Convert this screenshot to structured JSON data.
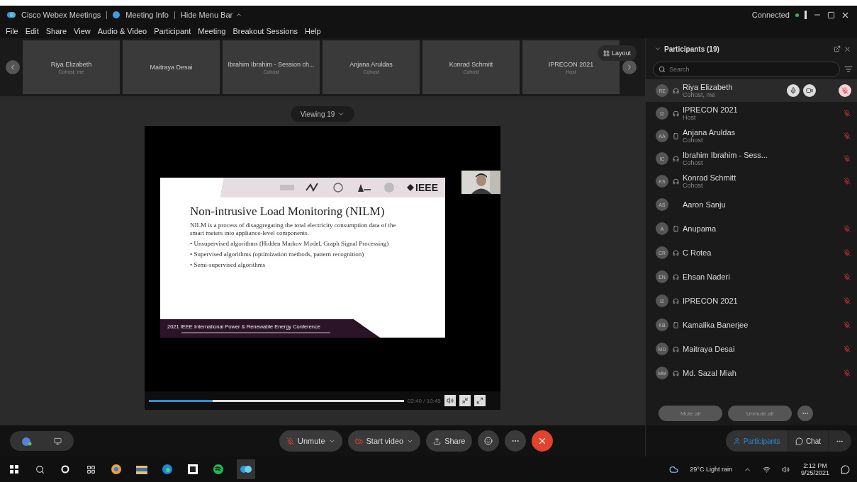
{
  "title_bar": {
    "app": "Cisco Webex Meetings",
    "meeting_info": "Meeting Info",
    "hide_menu": "Hide Menu Bar",
    "status": "Connected"
  },
  "menu": [
    "File",
    "Edit",
    "Share",
    "View",
    "Audio & Video",
    "Participant",
    "Meeting",
    "Breakout Sessions",
    "Help"
  ],
  "filmstrip": [
    {
      "name": "Riya Elizabeth",
      "role": "Cohost, me"
    },
    {
      "name": "Maitraya Desai"
    },
    {
      "name": "Ibrahim Ibrahim - Session ch...",
      "role": "Cohost"
    },
    {
      "name": "Anjana Aruldas",
      "role": "Cohost"
    },
    {
      "name": "Konrad Schmitt",
      "role": "Cohost"
    },
    {
      "name": "IPRECON 2021",
      "role": "Host"
    }
  ],
  "layout_button": "Layout",
  "viewing": "Viewing 19",
  "slide": {
    "logo_text": "IEEE",
    "title": "Non-intrusive Load Monitoring (NILM)",
    "paragraph": "NILM is a process of disaggregating the total electricity consumption data of the smart meters into appliance-level components.",
    "bullets": [
      "• Unsupervised algorithms (Hidden Markov Model, Graph Signal Processing)",
      "• Supervised algorithms (optimization methods, pattern recognition)",
      "• Semi-supervised algorithms"
    ],
    "footer": "2021 IEEE International Power & Renewable Energy Conference"
  },
  "player": {
    "level": 0.25,
    "time": "02:40 / 10:45"
  },
  "panel": {
    "title": "Participants (19)",
    "search_placeholder": "Search",
    "participants": [
      {
        "initials": "RE",
        "name": "Riya Elizabeth",
        "role": "Cohost, me",
        "kind": "headset",
        "muted": true,
        "selected": true
      },
      {
        "initials": "I2",
        "name": "IPRECON 2021",
        "role": "Host",
        "kind": "headset",
        "muted": true,
        "selected": false
      },
      {
        "initials": "AA",
        "name": "Anjana Aruldas",
        "role": "Cohost",
        "kind": "phone",
        "muted": true,
        "selected": false
      },
      {
        "initials": "IC",
        "name": "Ibrahim Ibrahim - Sess...",
        "role": "Cohost",
        "kind": "headset",
        "muted": true,
        "selected": false
      },
      {
        "initials": "KS",
        "name": "Konrad Schmitt",
        "role": "Cohost",
        "kind": "headset",
        "muted": true,
        "selected": false
      },
      {
        "initials": "AS",
        "name": "Aaron Sanju",
        "kind": "plain",
        "muted": false,
        "selected": false
      },
      {
        "initials": "A",
        "name": "Anupama",
        "kind": "phone",
        "muted": true,
        "selected": false
      },
      {
        "initials": "CR",
        "name": "C Rotea",
        "kind": "headset",
        "muted": true,
        "selected": false
      },
      {
        "initials": "EN",
        "name": "Ehsan Naderi",
        "kind": "headset",
        "muted": true,
        "selected": false
      },
      {
        "initials": "I2",
        "name": "IPRECON 2021",
        "kind": "headset",
        "muted": true,
        "selected": false
      },
      {
        "initials": "KB",
        "name": "Kamalika Banerjee",
        "kind": "phone",
        "muted": true,
        "selected": false
      },
      {
        "initials": "MD",
        "name": "Maitraya Desai",
        "kind": "headset",
        "muted": true,
        "selected": false
      },
      {
        "initials": "MM",
        "name": "Md. Sazal Miah",
        "kind": "headset",
        "muted": true,
        "selected": false
      }
    ],
    "buttons": [
      "Mute all",
      "Unmute all"
    ]
  },
  "controls": {
    "unmute": "Unmute",
    "video": "Start video",
    "share": "Share"
  },
  "side_tabs": [
    {
      "label": "Participants",
      "selected": true
    },
    {
      "label": "Chat",
      "selected": false
    }
  ],
  "taskbar": {
    "weather": "29°C  Light rain",
    "time": "2:12 PM",
    "date": "9/25/2021"
  }
}
